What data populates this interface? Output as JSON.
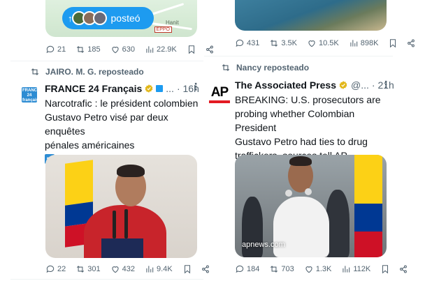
{
  "left_top_post": {
    "posted_pill_label": "posteó",
    "map_label": "Hanit",
    "map_badge": "EPPO",
    "stats": {
      "replies": "21",
      "reposts": "185",
      "likes": "630",
      "views": "22.9K"
    }
  },
  "right_top_post": {
    "stats": {
      "replies": "431",
      "reposts": "3.5K",
      "likes": "10.5K",
      "views": "898K"
    }
  },
  "left_post": {
    "repost_by": "JAIRO. M. G. reposteado",
    "avatar_text": "FRANCE 24 français",
    "author": "FRANCE 24 Français",
    "handle": "...",
    "time": "· 16h",
    "text_lines": [
      "Narcotrafic : le président colombien",
      "Gustavo Petro visé par deux enquêtes",
      "pénales américaines"
    ],
    "link": "go.france24.com/Rul",
    "stats": {
      "replies": "22",
      "reposts": "301",
      "likes": "432",
      "views": "9.4K"
    }
  },
  "right_post": {
    "repost_by": "Nancy reposteado",
    "avatar_text": "AP",
    "author": "The Associated Press",
    "handle": "@...",
    "time": "· 21h",
    "text_lines": [
      "BREAKING: U.S. prosecutors are",
      "probing whether Colombian President",
      "Gustavo Petro had ties to drug",
      "traffickers, sources tell AP."
    ],
    "media_caption": "apnews.com",
    "stats": {
      "replies": "184",
      "reposts": "703",
      "likes": "1.3K",
      "views": "112K"
    }
  },
  "colors": {
    "accent": "#1d9bf0",
    "muted": "#536471",
    "verified": "#e2b719",
    "ap_red": "#e31b23"
  }
}
